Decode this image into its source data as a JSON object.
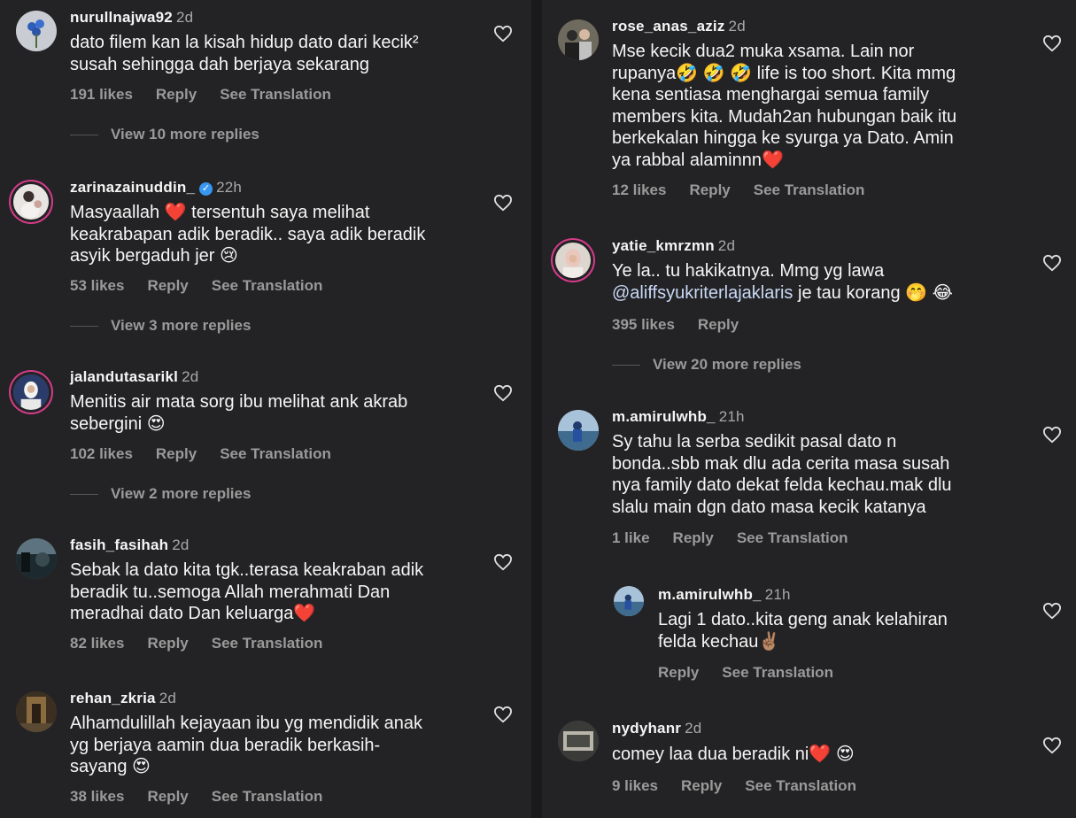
{
  "left": [
    {
      "user": "nurullnajwa92",
      "time": "2d",
      "text": "dato filem kan la kisah hidup dato dari kecik²\nsusah sehingga dah berjaya sekarang",
      "likes": "191 likes",
      "reply": "Reply",
      "translate": "See Translation",
      "view_more": "View 10 more replies"
    },
    {
      "user": "zarinazainuddin_",
      "time": "22h",
      "verified": "✓",
      "text": "Masyaallah ❤️  tersentuh saya melihat\nkeakrabapan adik beradik.. saya adik beradik\nasyik bergaduh jer 😢",
      "likes": "53 likes",
      "reply": "Reply",
      "translate": "See Translation",
      "view_more": "View 3 more replies"
    },
    {
      "user": "jalandutasarikl",
      "time": "2d",
      "text": "Menitis air mata sorg ibu melihat ank akrab\nsebergini 😍",
      "likes": "102 likes",
      "reply": "Reply",
      "translate": "See Translation",
      "view_more": "View 2 more replies"
    },
    {
      "user": "fasih_fasihah",
      "time": "2d",
      "text": "Sebak la dato kita tgk..terasa keakraban adik\nberadik tu..semoga Allah merahmati Dan\nmeradhai dato Dan keluarga❤️",
      "likes": "82 likes",
      "reply": "Reply",
      "translate": "See Translation"
    },
    {
      "user": "rehan_zkria",
      "time": "2d",
      "text": "Alhamdulillah kejayaan ibu yg mendidik anak\nyg berjaya aamin dua beradik berkasih-\nsayang 😍",
      "likes": "38 likes",
      "reply": "Reply",
      "translate": "See Translation"
    }
  ],
  "right": [
    {
      "user": "rose_anas_aziz",
      "time": "2d",
      "text": "Mse kecik dua2 muka xsama. Lain nor\nrupanya🤣 🤣 🤣  life is too short. Kita mmg\nkena sentiasa menghargai semua family\nmembers kita. Mudah2an hubungan baik itu\nberkekalan hingga ke syurga ya Dato. Amin\nya rabbal alaminnn❤️",
      "likes": "12 likes",
      "reply": "Reply",
      "translate": "See Translation"
    },
    {
      "user": "yatie_kmrzmn",
      "time": "2d",
      "text_pre": "Ye la.. tu hakikatnya. Mmg yg lawa\n",
      "mention": "@aliffsyukriterlajaklaris",
      "text_post": " je tau korang 🤭 😂",
      "likes": "395 likes",
      "reply": "Reply",
      "view_more": "View 20 more replies"
    },
    {
      "user": "m.amirulwhb_",
      "time": "21h",
      "text": "Sy tahu la serba sedikit pasal dato n\nbonda..sbb mak dlu ada cerita masa susah\nnya family dato dekat felda kechau.mak dlu\nslalu main dgn dato masa kecik katanya",
      "likes": "1 like",
      "reply": "Reply",
      "translate": "See Translation"
    },
    {
      "user": "m.amirulwhb_",
      "time": "21h",
      "text": "Lagi 1 dato..kita geng anak kelahiran\nfelda kechau✌🏽",
      "reply": "Reply",
      "translate": "See Translation"
    },
    {
      "user": "nydyhanr",
      "time": "2d",
      "text": "comey laa dua beradik ni❤️ 😍",
      "likes": "9 likes",
      "reply": "Reply",
      "translate": "See Translation"
    }
  ],
  "colors": {
    "background": "#232325",
    "text": "#f5f5f5",
    "muted": "#9a9a9a",
    "ring": "#d63b8a",
    "verified": "#3897f0"
  },
  "icons": {
    "like": "heart-outline-icon",
    "verified": "verified-badge-icon"
  }
}
